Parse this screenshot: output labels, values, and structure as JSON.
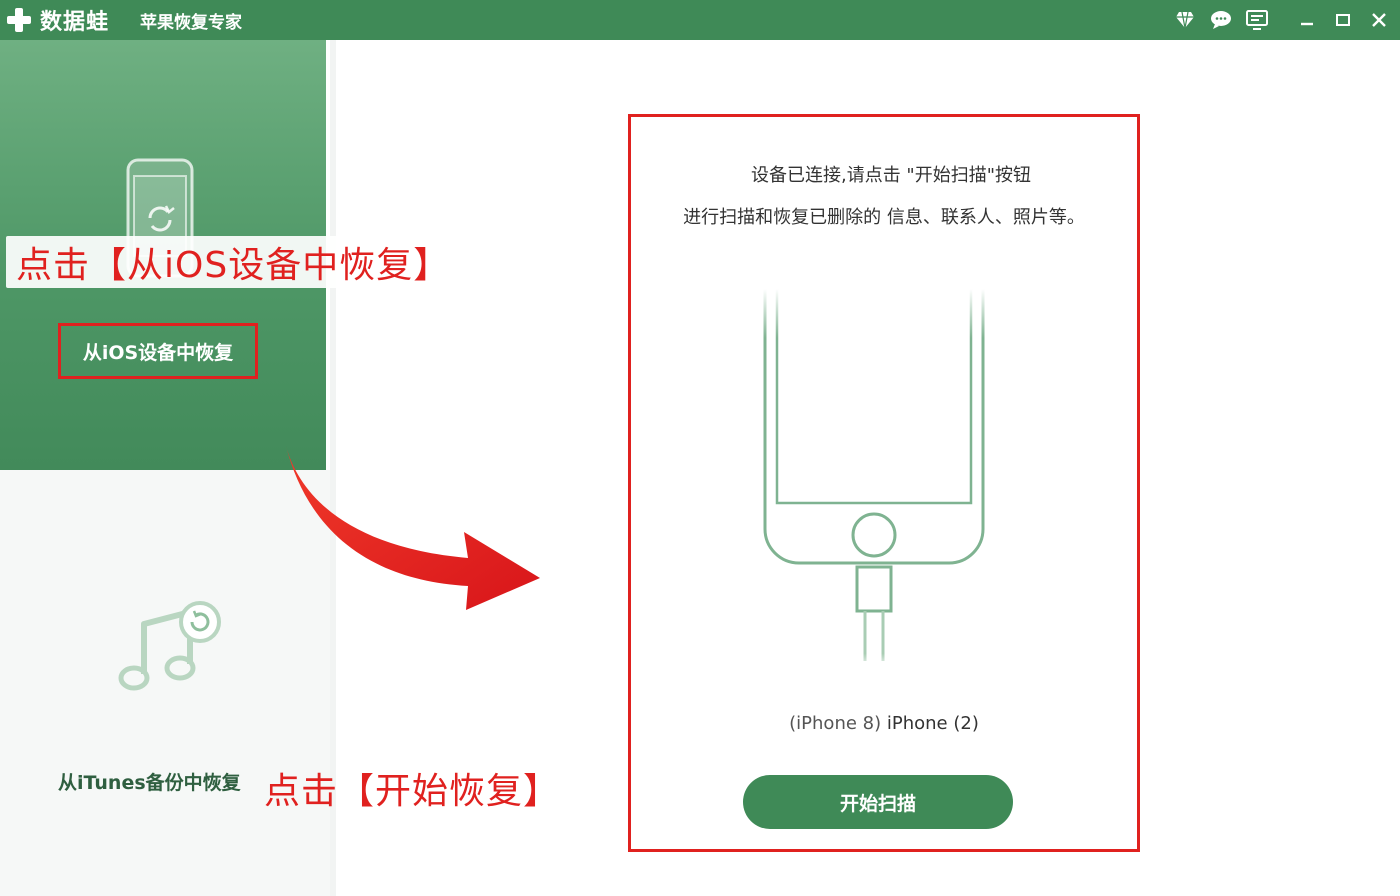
{
  "titlebar": {
    "brand": "数据蛙",
    "product": "苹果恢复专家",
    "icons": [
      "diamond-icon",
      "chat-icon",
      "screen-icon",
      "minimize-icon",
      "maximize-icon",
      "close-icon"
    ]
  },
  "sidebar": {
    "ios_item": {
      "label": "从iOS设备中恢复",
      "icon": "phone-restore-icon"
    },
    "itunes_item": {
      "label": "从iTunes备份中恢复",
      "icon": "music-restore-icon"
    }
  },
  "annotations": {
    "ios_hint": "点击【从iOS设备中恢复】",
    "scan_hint": "点击【开始恢复】"
  },
  "main": {
    "instruction_line1": "设备已连接,请点击 \"开始扫描\"按钮",
    "instruction_line2": "进行扫描和恢复已删除的 信息、联系人、照片等。",
    "device_model": "(iPhone 8)",
    "device_name": "iPhone (2)",
    "scan_button": "开始扫描"
  },
  "colors": {
    "brand_green": "#3f8a57",
    "annotation_red": "#e0211f"
  }
}
